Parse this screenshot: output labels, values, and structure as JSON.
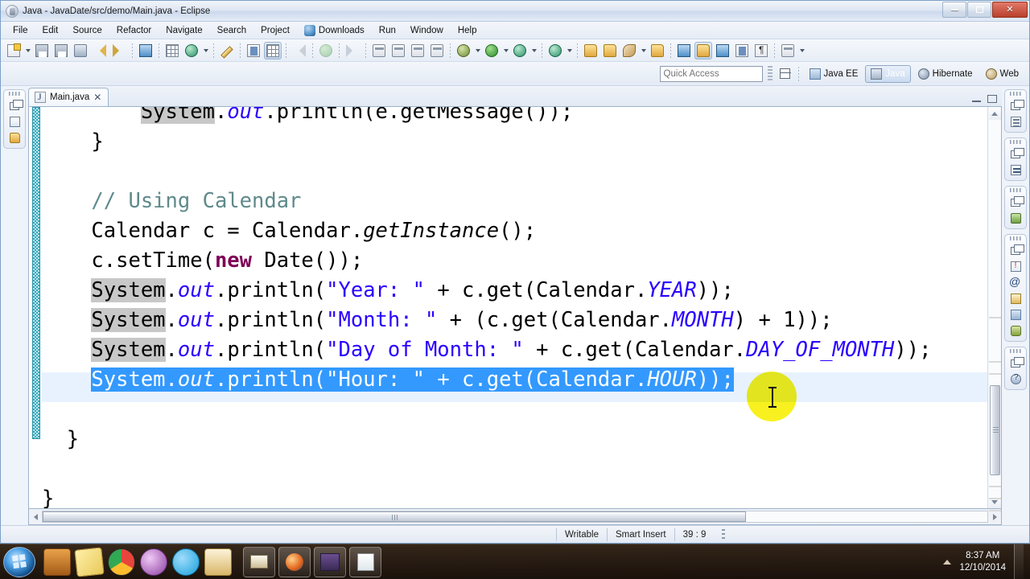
{
  "window": {
    "title": "Java - JavaDate/src/demo/Main.java - Eclipse",
    "buttons": {
      "minimize": "−",
      "restore": "❐",
      "close": "✕"
    }
  },
  "menubar": {
    "items": [
      {
        "label": "File"
      },
      {
        "label": "Edit"
      },
      {
        "label": "Source"
      },
      {
        "label": "Refactor"
      },
      {
        "label": "Navigate"
      },
      {
        "label": "Search"
      },
      {
        "label": "Project"
      },
      {
        "label": "Downloads",
        "icon": "downloads-icon"
      },
      {
        "label": "Run"
      },
      {
        "label": "Window"
      },
      {
        "label": "Help"
      }
    ]
  },
  "toolbar": {
    "groups": [
      {
        "items": [
          {
            "name": "new-wizard",
            "icon": "new-file-icon",
            "dropdown": true
          },
          {
            "name": "save",
            "icon": "save-icon"
          },
          {
            "name": "save-all",
            "icon": "save-all-icon"
          },
          {
            "name": "print",
            "icon": "print-icon"
          },
          {
            "name": "undo",
            "icon": "undo-arrow-icon"
          },
          {
            "name": "redo",
            "icon": "redo-arrow-icon"
          }
        ]
      },
      {
        "items": [
          {
            "name": "new-java-package",
            "icon": "package-icon"
          }
        ]
      },
      {
        "items": [
          {
            "name": "new-java-class",
            "icon": "new-class-icon"
          },
          {
            "name": "new-java-project",
            "icon": "new-project-icon",
            "dropdown": true
          }
        ]
      },
      {
        "items": [
          {
            "name": "toggle-mark-occurrences",
            "icon": "pencil-strike-icon"
          }
        ]
      },
      {
        "items": [
          {
            "name": "open-task",
            "icon": "task-list-icon"
          },
          {
            "name": "skip-all-breakpoints",
            "icon": "breakpoints-icon",
            "active": true
          }
        ]
      },
      {
        "items": [
          {
            "name": "step-return",
            "icon": "step-return-icon"
          },
          {
            "name": "resume",
            "icon": "resume-icon"
          },
          {
            "name": "step-over",
            "icon": "step-over-icon"
          }
        ]
      },
      {
        "items": [
          {
            "name": "resume-debug",
            "icon": "resume-debug-icon"
          },
          {
            "name": "suspend",
            "icon": "suspend-icon"
          },
          {
            "name": "terminate",
            "icon": "terminate-icon"
          },
          {
            "name": "disconnect",
            "icon": "disconnect-icon"
          }
        ]
      },
      {
        "items": [
          {
            "name": "debug",
            "icon": "debug-bug-icon",
            "dropdown": true
          },
          {
            "name": "run",
            "icon": "run-green-icon",
            "dropdown": true
          },
          {
            "name": "run-external-tools",
            "icon": "external-tools-icon",
            "dropdown": true
          }
        ]
      },
      {
        "items": [
          {
            "name": "coverage",
            "icon": "coverage-icon",
            "dropdown": true
          }
        ]
      },
      {
        "items": [
          {
            "name": "open-type",
            "icon": "open-type-icon"
          },
          {
            "name": "open-task-folder",
            "icon": "open-folder-icon"
          },
          {
            "name": "search",
            "icon": "search-rocket-icon",
            "dropdown": true
          },
          {
            "name": "open-resource",
            "icon": "open-resource-icon"
          }
        ]
      },
      {
        "items": [
          {
            "name": "next-annotation",
            "icon": "next-annotation-icon"
          },
          {
            "name": "previous-annotation",
            "icon": "previous-annotation-icon",
            "active": true
          },
          {
            "name": "last-edit-location",
            "icon": "last-edit-icon"
          }
        ]
      },
      {
        "items": [
          {
            "name": "toggle-block-selection",
            "icon": "block-selection-icon"
          },
          {
            "name": "show-whitespace",
            "icon": "whitespace-pilcrow-icon"
          }
        ]
      },
      {
        "items": [
          {
            "name": "data-source-explorer",
            "icon": "database-icon",
            "dropdown": true
          }
        ]
      }
    ]
  },
  "quick_access": {
    "placeholder": "Quick Access",
    "value": ""
  },
  "perspectives": {
    "open_button_name": "open-perspective",
    "items": [
      {
        "label": "Java EE",
        "selected": false,
        "icon": "java-ee-perspective-icon"
      },
      {
        "label": "Java",
        "selected": true,
        "icon": "java-perspective-icon"
      },
      {
        "label": "Hibernate",
        "selected": false,
        "icon": "hibernate-perspective-icon"
      },
      {
        "label": "Web",
        "selected": false,
        "icon": "web-perspective-icon"
      }
    ]
  },
  "left_stacks": [
    {
      "icons": [
        "restore-icon",
        "package-explorer-icon",
        "project-explorer-icon"
      ]
    }
  ],
  "right_stacks": [
    {
      "icons": [
        "restore-icon",
        "outline-view-icon"
      ]
    },
    {
      "icons": [
        "restore-icon",
        "task-list-icon"
      ]
    },
    {
      "icons": [
        "restore-icon",
        "servers-view-icon"
      ]
    },
    {
      "icons": [
        "restore-icon",
        "problems-view-icon",
        "annotations-icon",
        "snippets-view-icon",
        "console-view-icon",
        "debug-view-icon"
      ]
    },
    {
      "icons": [
        "restore-icon",
        "help-view-icon"
      ]
    }
  ],
  "editor": {
    "tab": {
      "label": "Main.java",
      "close": "✕",
      "icon": "java-file-icon"
    },
    "minimize_label": "Minimize",
    "maximize_label": "Maximize",
    "lines": [
      {
        "id": "line-clipped-top",
        "indent": 4,
        "clipped_top": true,
        "segments": [
          {
            "t": "System",
            "c": "occ"
          },
          {
            "t": ".",
            "c": ""
          },
          {
            "t": "out",
            "c": "fld"
          },
          {
            "t": ".println(e.getMessage());",
            "c": ""
          }
        ]
      },
      {
        "id": "line-close-brace-catch",
        "indent": 2,
        "segments": [
          {
            "t": "}",
            "c": ""
          }
        ]
      },
      {
        "id": "line-blank-1",
        "indent": 0,
        "segments": [
          {
            "t": "",
            "c": ""
          }
        ]
      },
      {
        "id": "line-comment-using-calendar",
        "indent": 2,
        "segments": [
          {
            "t": "// Using Calendar",
            "c": "cmt"
          }
        ]
      },
      {
        "id": "line-calendar-getinstance",
        "indent": 2,
        "segments": [
          {
            "t": "Calendar c = Calendar.",
            "c": ""
          },
          {
            "t": "getInstance",
            "c": "stat"
          },
          {
            "t": "();",
            "c": ""
          }
        ]
      },
      {
        "id": "line-settime",
        "indent": 2,
        "segments": [
          {
            "t": "c.setTime(",
            "c": ""
          },
          {
            "t": "new",
            "c": "kw"
          },
          {
            "t": " Date());",
            "c": ""
          }
        ]
      },
      {
        "id": "line-println-year",
        "indent": 2,
        "segments": [
          {
            "t": "System",
            "c": "occ"
          },
          {
            "t": ".",
            "c": ""
          },
          {
            "t": "out",
            "c": "fld"
          },
          {
            "t": ".println(",
            "c": ""
          },
          {
            "t": "\"Year: \"",
            "c": "str"
          },
          {
            "t": " + c.get(Calendar.",
            "c": ""
          },
          {
            "t": "YEAR",
            "c": "fld"
          },
          {
            "t": "));",
            "c": ""
          }
        ]
      },
      {
        "id": "line-println-month",
        "indent": 2,
        "segments": [
          {
            "t": "System",
            "c": "occ"
          },
          {
            "t": ".",
            "c": ""
          },
          {
            "t": "out",
            "c": "fld"
          },
          {
            "t": ".println(",
            "c": ""
          },
          {
            "t": "\"Month: \"",
            "c": "str"
          },
          {
            "t": " + (c.get(Calendar.",
            "c": ""
          },
          {
            "t": "MONTH",
            "c": "fld"
          },
          {
            "t": ") + 1));",
            "c": ""
          }
        ]
      },
      {
        "id": "line-println-day",
        "indent": 2,
        "segments": [
          {
            "t": "System",
            "c": "occ"
          },
          {
            "t": ".",
            "c": ""
          },
          {
            "t": "out",
            "c": "fld"
          },
          {
            "t": ".println(",
            "c": ""
          },
          {
            "t": "\"Day of Month: \"",
            "c": "str"
          },
          {
            "t": " + c.get(Calendar.",
            "c": ""
          },
          {
            "t": "DAY_OF_MONTH",
            "c": "fld"
          },
          {
            "t": "));",
            "c": ""
          }
        ]
      },
      {
        "id": "line-println-hour",
        "indent": 2,
        "selected": true,
        "segments": [
          {
            "t": "System",
            "c": ""
          },
          {
            "t": ".",
            "c": ""
          },
          {
            "t": "out",
            "c": "stat"
          },
          {
            "t": ".println(",
            "c": ""
          },
          {
            "t": "\"Hour: \"",
            "c": ""
          },
          {
            "t": " + c.get(Calendar.",
            "c": ""
          },
          {
            "t": "HOUR",
            "c": "stat"
          },
          {
            "t": "));",
            "c": ""
          }
        ]
      },
      {
        "id": "line-blank-2",
        "indent": 0,
        "segments": [
          {
            "t": "",
            "c": ""
          }
        ]
      },
      {
        "id": "line-close-brace-main",
        "indent": 1,
        "segments": [
          {
            "t": "}",
            "c": ""
          }
        ]
      },
      {
        "id": "line-blank-3",
        "indent": 0,
        "segments": [
          {
            "t": "",
            "c": ""
          }
        ]
      },
      {
        "id": "line-close-brace-class",
        "indent": 0,
        "segments": [
          {
            "t": "}",
            "c": ""
          }
        ]
      }
    ]
  },
  "statusbar": {
    "writable": "Writable",
    "insert_mode": "Smart Insert",
    "position": "39 : 9"
  },
  "taskbar": {
    "start_label": "Start",
    "pinned": [
      {
        "name": "media-player-icon"
      },
      {
        "name": "sticky-notes-icon"
      },
      {
        "name": "chrome-icon"
      },
      {
        "name": "smiley-app-icon"
      },
      {
        "name": "skype-icon"
      },
      {
        "name": "clock-app-icon"
      }
    ],
    "running": [
      {
        "name": "file-explorer-window"
      },
      {
        "name": "firefox-window"
      },
      {
        "name": "eclipse-java-ee-ide-window"
      },
      {
        "name": "notepad-window"
      }
    ],
    "clock": {
      "time": "8:37 AM",
      "date": "12/10/2014"
    }
  },
  "colors": {
    "selection_blue": "#3399ff",
    "current_line": "#e8f2fe",
    "occurrence_gray": "#c8c8c8",
    "string_blue": "#2a00ff",
    "keyword_purple": "#7f0055",
    "comment_green": "#5f8a8b",
    "cursor_highlight_yellow": "#f7f000"
  }
}
